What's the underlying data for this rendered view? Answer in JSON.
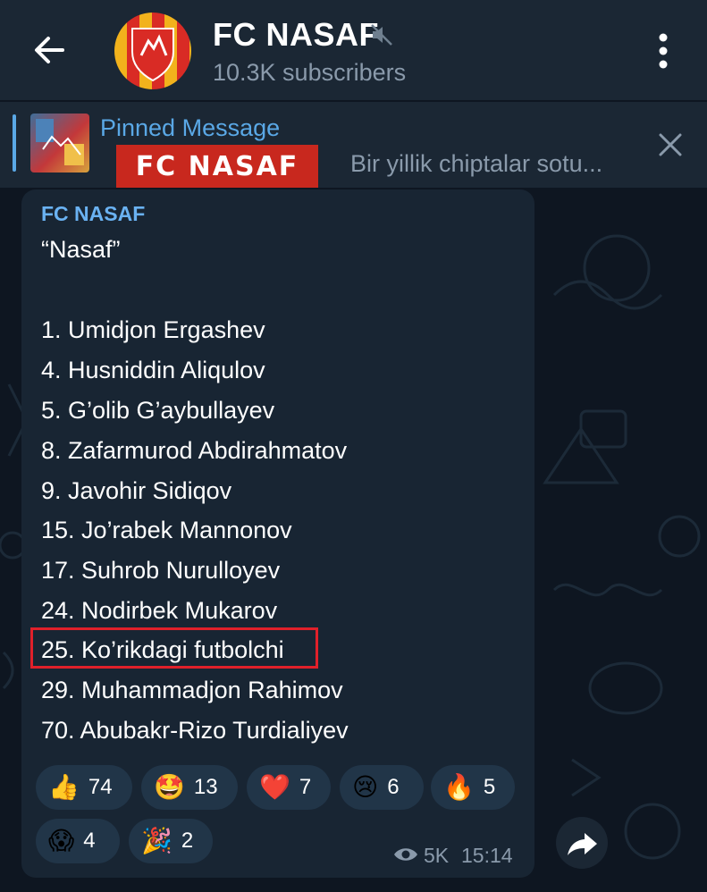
{
  "header": {
    "title": "FC NASAF",
    "subscribers": "10.3K subscribers"
  },
  "pinned": {
    "label": "Pinned Message",
    "logo_text": "FC NASAF",
    "preview": "Bir yillik chiptalar sotu..."
  },
  "message": {
    "sender": "FC NASAF",
    "title": "“Nasaf”",
    "players": [
      "1. Umidjon Ergashev",
      "4. Husniddin Aliqulov",
      "5. G’olib G’aybullayev",
      "8. Zafarmurod Abdirahmatov",
      "9. Javohir Sidiqov",
      "15. Jo’rabek Mannonov",
      "17. Suhrob Nurulloyev",
      "24. Nodirbek Mukarov",
      "25. Ko’rikdagi futbolchi",
      "29. Muhammadjon Rahimov",
      "70. Abubakr-Rizo Turdialiyev"
    ],
    "reactions": [
      {
        "emoji": "👍",
        "count": "74",
        "icon": "thumbs-up"
      },
      {
        "emoji": "🤩",
        "count": "13",
        "icon": "star-struck"
      },
      {
        "emoji": "❤️",
        "count": "7",
        "icon": "heart"
      },
      {
        "emoji": "😢",
        "count": "6",
        "icon": "crying-face"
      },
      {
        "emoji": "🔥",
        "count": "5",
        "icon": "fire"
      },
      {
        "emoji": "😱",
        "count": "4",
        "icon": "screaming-face"
      },
      {
        "emoji": "🎉",
        "count": "2",
        "icon": "party-popper"
      }
    ],
    "views": "5K",
    "time": "15:14"
  },
  "colors": {
    "header_bg": "#1b2734",
    "bubble_bg": "#182533",
    "accent": "#6ab2f2",
    "highlight": "#e0202a"
  }
}
